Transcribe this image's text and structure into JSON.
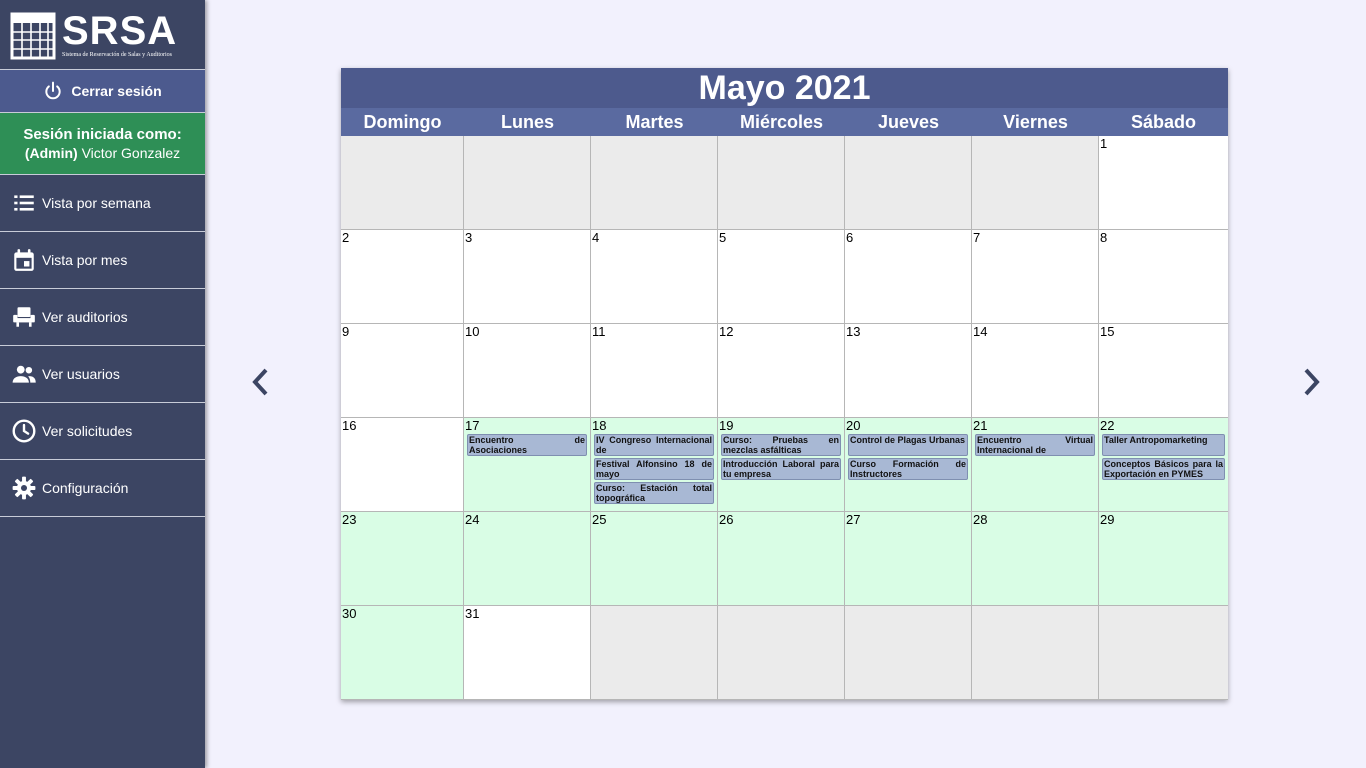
{
  "logo": {
    "title": "SRSA",
    "subtitle": "Sistema de Reservación de Salas y Auditorios"
  },
  "sidebar": {
    "logout_label": "Cerrar sesión",
    "session_line1": "Sesión iniciada como:",
    "session_role": "(Admin)",
    "session_user": " Victor Gonzalez",
    "items": [
      {
        "label": "Vista por semana",
        "icon": "list-icon"
      },
      {
        "label": "Vista por mes",
        "icon": "calendar-icon"
      },
      {
        "label": "Ver auditorios",
        "icon": "armchair-icon"
      },
      {
        "label": "Ver usuarios",
        "icon": "users-icon"
      },
      {
        "label": "Ver solicitudes",
        "icon": "clock-icon"
      },
      {
        "label": "Configuración",
        "icon": "gear-icon"
      }
    ]
  },
  "calendar": {
    "title": "Mayo 2021",
    "weekdays": [
      "Domingo",
      "Lunes",
      "Martes",
      "Miércoles",
      "Jueves",
      "Viernes",
      "Sábado"
    ],
    "days": [
      {
        "n": "",
        "state": "empty",
        "events": []
      },
      {
        "n": "",
        "state": "empty",
        "events": []
      },
      {
        "n": "",
        "state": "empty",
        "events": []
      },
      {
        "n": "",
        "state": "empty",
        "events": []
      },
      {
        "n": "",
        "state": "empty",
        "events": []
      },
      {
        "n": "",
        "state": "empty",
        "events": []
      },
      {
        "n": "1",
        "state": "white",
        "events": []
      },
      {
        "n": "2",
        "state": "white",
        "events": []
      },
      {
        "n": "3",
        "state": "white",
        "events": []
      },
      {
        "n": "4",
        "state": "white",
        "events": []
      },
      {
        "n": "5",
        "state": "white",
        "events": []
      },
      {
        "n": "6",
        "state": "white",
        "events": []
      },
      {
        "n": "7",
        "state": "white",
        "events": []
      },
      {
        "n": "8",
        "state": "white",
        "events": []
      },
      {
        "n": "9",
        "state": "white",
        "events": []
      },
      {
        "n": "10",
        "state": "white",
        "events": []
      },
      {
        "n": "11",
        "state": "white",
        "events": []
      },
      {
        "n": "12",
        "state": "white",
        "events": []
      },
      {
        "n": "13",
        "state": "white",
        "events": []
      },
      {
        "n": "14",
        "state": "white",
        "events": []
      },
      {
        "n": "15",
        "state": "white",
        "events": []
      },
      {
        "n": "16",
        "state": "white",
        "events": []
      },
      {
        "n": "17",
        "state": "green",
        "events": [
          "Encuentro de Asociaciones"
        ]
      },
      {
        "n": "18",
        "state": "green",
        "events": [
          "IV Congreso Internacional de",
          "Festival Alfonsino 18 de mayo",
          "Curso: Estación total topográfica"
        ]
      },
      {
        "n": "19",
        "state": "green",
        "events": [
          "Curso: Pruebas en mezclas asfálticas",
          "Introducción Laboral para tu empresa"
        ]
      },
      {
        "n": "20",
        "state": "green",
        "events": [
          "Control de Plagas Urbanas",
          "Curso Formación de Instructores"
        ]
      },
      {
        "n": "21",
        "state": "green",
        "events": [
          "Encuentro Virtual Internacional de"
        ]
      },
      {
        "n": "22",
        "state": "green",
        "events": [
          "Taller Antropomarketing",
          "Conceptos Básicos para la Exportación en PYMES"
        ]
      },
      {
        "n": "23",
        "state": "green",
        "events": []
      },
      {
        "n": "24",
        "state": "green",
        "events": []
      },
      {
        "n": "25",
        "state": "green",
        "events": []
      },
      {
        "n": "26",
        "state": "green",
        "events": []
      },
      {
        "n": "27",
        "state": "green",
        "events": []
      },
      {
        "n": "28",
        "state": "green",
        "events": []
      },
      {
        "n": "29",
        "state": "green",
        "events": []
      },
      {
        "n": "30",
        "state": "green",
        "events": []
      },
      {
        "n": "31",
        "state": "white",
        "events": []
      },
      {
        "n": "",
        "state": "empty",
        "events": []
      },
      {
        "n": "",
        "state": "empty",
        "events": []
      },
      {
        "n": "",
        "state": "empty",
        "events": []
      },
      {
        "n": "",
        "state": "empty",
        "events": []
      },
      {
        "n": "",
        "state": "empty",
        "events": []
      }
    ]
  },
  "nav": {
    "prev_icon": "chevron-left-icon",
    "next_icon": "chevron-right-icon"
  },
  "colors": {
    "sidebar": "#3c4563",
    "logout": "#4c5a8e",
    "session": "#2e8f56",
    "header": "#4d5a8d",
    "reserved_day": "#d9fde5",
    "event": "#a8b8d4"
  }
}
